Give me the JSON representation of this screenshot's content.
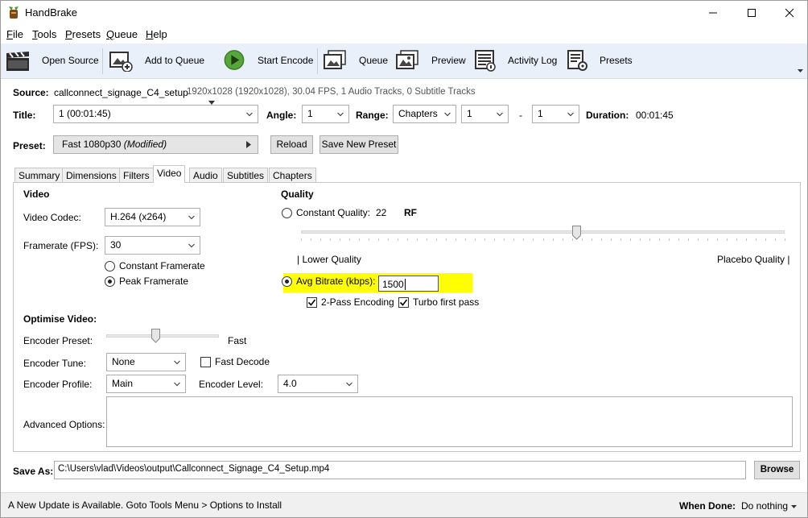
{
  "window": {
    "title": "HandBrake"
  },
  "menu": {
    "items": [
      {
        "u": "F",
        "rest": "ile"
      },
      {
        "u": "T",
        "rest": "ools"
      },
      {
        "u": "P",
        "rest": "resets"
      },
      {
        "u": "Q",
        "rest": "ueue"
      },
      {
        "u": "H",
        "rest": "elp"
      }
    ]
  },
  "toolbar": {
    "open_source": "Open Source",
    "add_to_queue": "Add to Queue",
    "start_encode": "Start Encode",
    "queue": "Queue",
    "preview": "Preview",
    "activity_log": "Activity Log",
    "presets": "Presets"
  },
  "source": {
    "label": "Source:",
    "name": "callconnect_signage_C4_setup",
    "info": "1920x1028 (1920x1028), 30.04 FPS, 1 Audio Tracks, 0 Subtitle Tracks"
  },
  "title_row": {
    "title_label": "Title:",
    "title_value": "1  (00:01:45)",
    "angle_label": "Angle:",
    "angle_value": "1",
    "range_label": "Range:",
    "range_value": "Chapters",
    "range_start": "1",
    "dash": "-",
    "range_end": "1",
    "duration_label": "Duration:",
    "duration_value": "00:01:45"
  },
  "preset": {
    "label": "Preset:",
    "value": "Fast 1080p30",
    "modified": "(Modified)",
    "reload": "Reload",
    "save_new": "Save New Preset"
  },
  "tabs": [
    "Summary",
    "Dimensions",
    "Filters",
    "Video",
    "Audio",
    "Subtitles",
    "Chapters"
  ],
  "video": {
    "heading": "Video",
    "codec_label": "Video Codec:",
    "codec_value": "H.264 (x264)",
    "framerate_label": "Framerate (FPS):",
    "framerate_value": "30",
    "constant_framerate": "Constant Framerate",
    "peak_framerate": "Peak Framerate"
  },
  "quality": {
    "heading": "Quality",
    "constant_quality": "Constant Quality:",
    "cq_value": "22",
    "rf": "RF",
    "slider_level": 0.57,
    "lower_quality": "| Lower Quality",
    "placebo_quality": "Placebo Quality |",
    "avg_bitrate": "Avg Bitrate (kbps):",
    "bitrate_value": "1500",
    "two_pass": "2-Pass Encoding",
    "turbo": "Turbo first pass"
  },
  "optimise": {
    "heading": "Optimise Video:",
    "encoder_preset_label": "Encoder Preset:",
    "encoder_preset_value": "Fast",
    "preset_slider_level": 0.44,
    "encoder_tune_label": "Encoder Tune:",
    "encoder_tune_value": "None",
    "fast_decode": "Fast Decode",
    "encoder_profile_label": "Encoder Profile:",
    "encoder_profile_value": "Main",
    "encoder_level_label": "Encoder Level:",
    "encoder_level_value": "4.0",
    "advanced_label": "Advanced Options:"
  },
  "save_as": {
    "label": "Save As:",
    "path": "C:\\Users\\vlad\\Videos\\output\\Callconnect_Signage_C4_Setup.mp4",
    "browse": "Browse"
  },
  "status": {
    "message": "A New Update is Available. Goto Tools Menu > Options to Install",
    "when_done_label": "When Done:",
    "when_done_value": "Do nothing"
  }
}
